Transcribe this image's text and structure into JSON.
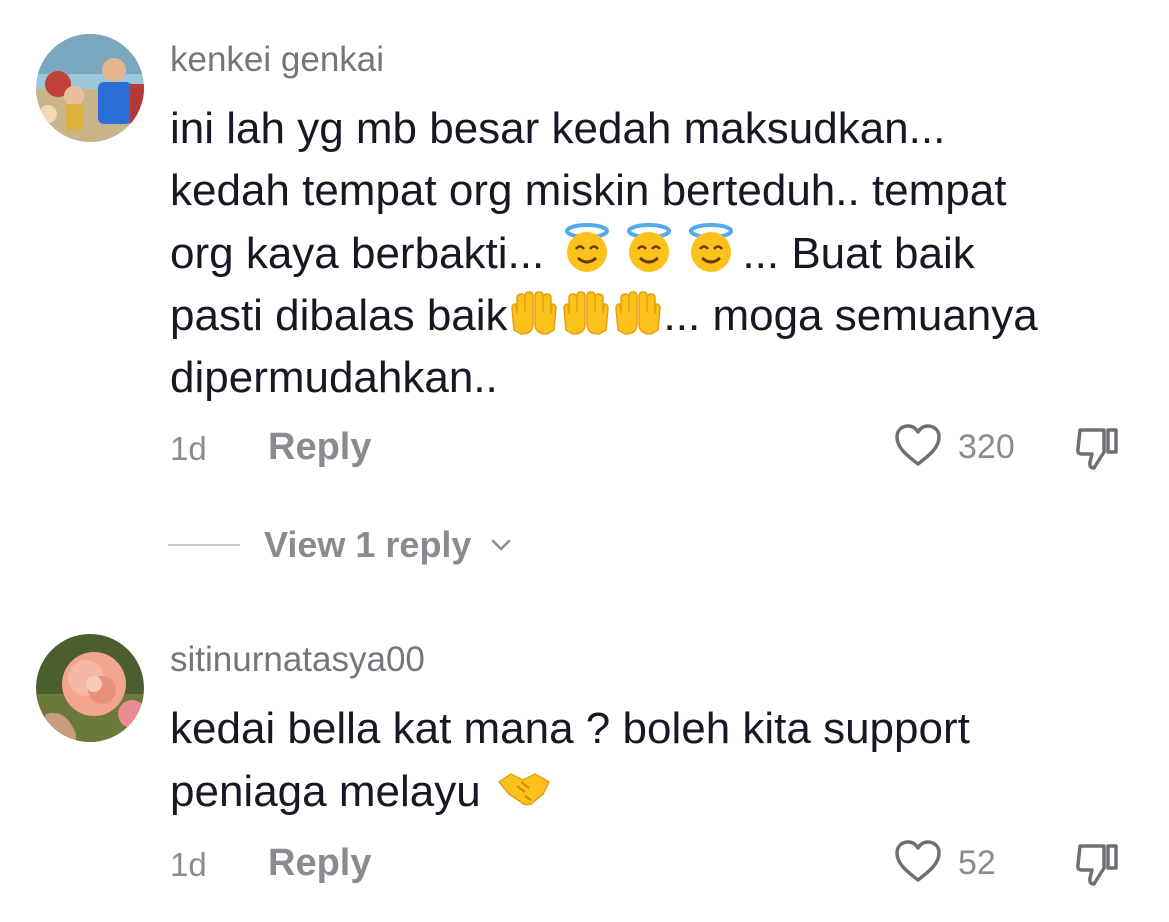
{
  "comments": [
    {
      "username": "kenkei genkai",
      "text_line1": "ini lah yg mb besar kedah maksudkan...",
      "text_line2": "kedah tempat org miskin berteduh.. tempat",
      "text_line3a": "org kaya berbakti... ",
      "text_line3b": "... Buat baik",
      "text_line4a": "pasti dibalas baik",
      "text_line4b": "... moga semuanya",
      "text_line5": "dipermudahkan..",
      "emoji_set1": "smiling-face-with-halo-emoji",
      "emoji_set2": "raising-hands-emoji",
      "time": "1d",
      "reply_label": "Reply",
      "like_count": "320",
      "view_replies_label": "View 1 reply"
    },
    {
      "username": "sitinurnatasya00",
      "text_line1": "kedai bella kat mana ? boleh kita support",
      "text_line2a": "peniaga melayu ",
      "emoji": "handshake-emoji",
      "time": "1d",
      "reply_label": "Reply",
      "like_count": "52"
    }
  ],
  "icons": {
    "like": "heart-outline-icon",
    "dislike": "thumbs-down-icon",
    "expand": "chevron-down-icon"
  },
  "colors": {
    "primary_text": "#161823",
    "secondary_text": "#8a8b91",
    "username": "#75757b"
  }
}
